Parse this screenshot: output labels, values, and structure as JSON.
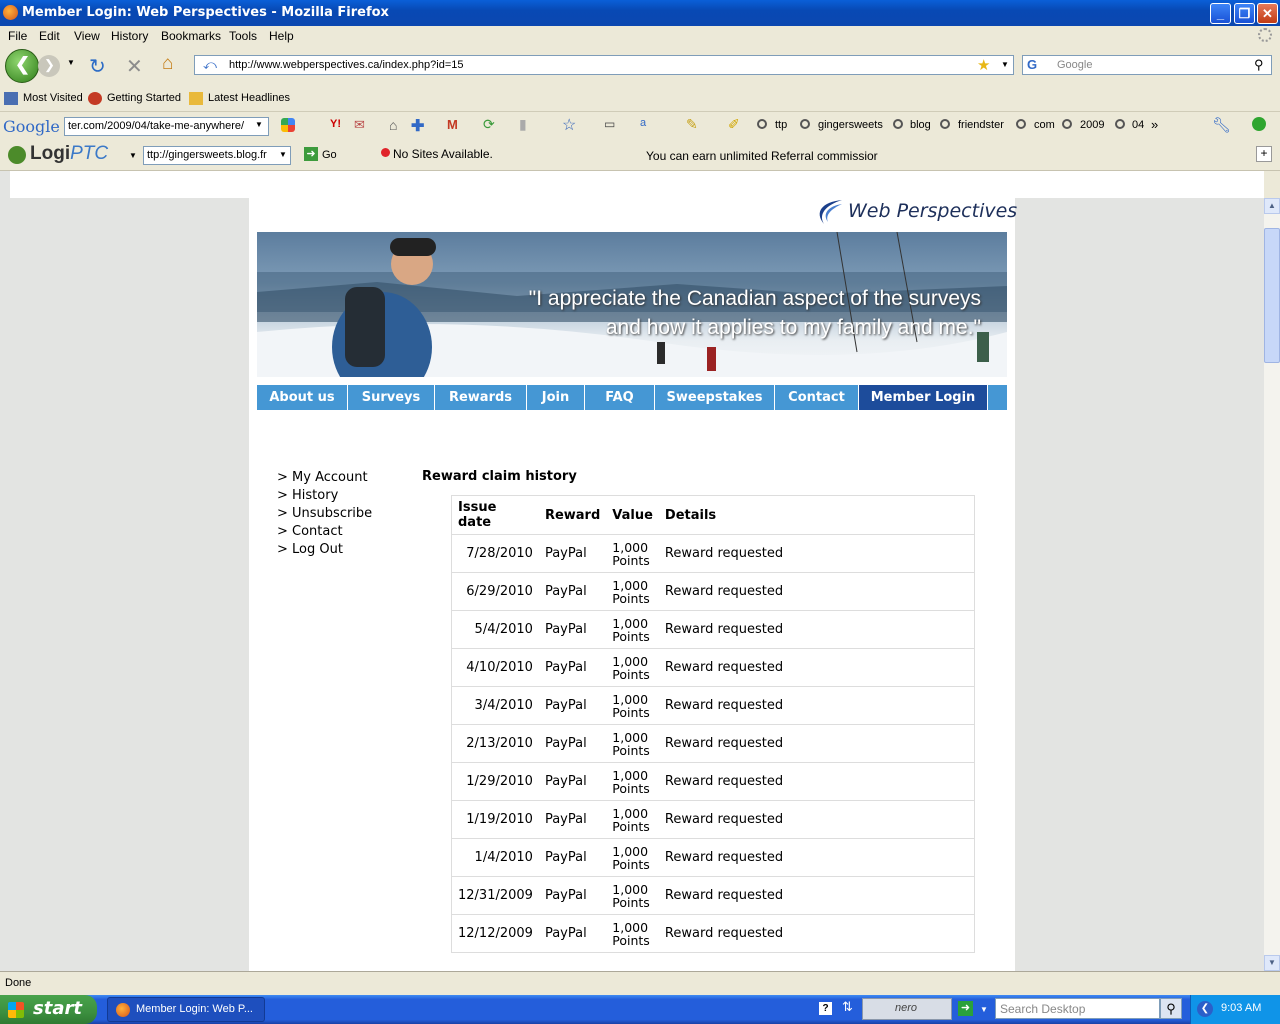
{
  "window": {
    "title": "Member Login: Web Perspectives - Mozilla Firefox"
  },
  "menu": [
    "File",
    "Edit",
    "View",
    "History",
    "Bookmarks",
    "Tools",
    "Help"
  ],
  "nav": {
    "url": "http://www.webperspectives.ca/index.php?id=15",
    "search_placeholder": "Google"
  },
  "bookmarks": [
    "Most Visited",
    "Getting Started",
    "Latest Headlines"
  ],
  "google_toolbar": {
    "logo": "Google",
    "field": "ter.com/2009/04/take-me-anywhere/",
    "links": [
      "ttp",
      "gingersweets",
      "blog",
      "friendster",
      "com",
      "2009",
      "04"
    ],
    "more": "»"
  },
  "logi_toolbar": {
    "logo_a": "Logi",
    "logo_b": "PTC",
    "field": "ttp://gingersweets.blog.fr",
    "go": "Go",
    "sites": "No Sites Available.",
    "ticker": "You can earn unlimited Referral commissior"
  },
  "site": {
    "brand": "Web Perspectives",
    "quote_line1": "\"I appreciate the Canadian aspect of the surveys",
    "quote_line2": "and how it applies to my family and me.\"",
    "tabs": [
      "About us",
      "Surveys",
      "Rewards",
      "Join",
      "FAQ",
      "Sweepstakes",
      "Contact",
      "Member Login"
    ],
    "sidenav": [
      "> My Account",
      "> History",
      "> Unsubscribe",
      "> Contact",
      "> Log Out"
    ],
    "section_title": "Reward claim history",
    "table": {
      "headers": [
        "Issue date",
        "Reward",
        "Value",
        "Details"
      ],
      "value_line1": "1,000",
      "value_line2": "Points",
      "rows": [
        {
          "date": "7/28/2010",
          "reward": "PayPal",
          "details": "Reward requested"
        },
        {
          "date": "6/29/2010",
          "reward": "PayPal",
          "details": "Reward requested"
        },
        {
          "date": "5/4/2010",
          "reward": "PayPal",
          "details": "Reward requested"
        },
        {
          "date": "4/10/2010",
          "reward": "PayPal",
          "details": "Reward requested"
        },
        {
          "date": "3/4/2010",
          "reward": "PayPal",
          "details": "Reward requested"
        },
        {
          "date": "2/13/2010",
          "reward": "PayPal",
          "details": "Reward requested"
        },
        {
          "date": "1/29/2010",
          "reward": "PayPal",
          "details": "Reward requested"
        },
        {
          "date": "1/19/2010",
          "reward": "PayPal",
          "details": "Reward requested"
        },
        {
          "date": "1/4/2010",
          "reward": "PayPal",
          "details": "Reward requested"
        },
        {
          "date": "12/31/2009",
          "reward": "PayPal",
          "details": "Reward requested"
        },
        {
          "date": "12/12/2009",
          "reward": "PayPal",
          "details": "Reward requested"
        }
      ]
    }
  },
  "status": "Done",
  "taskbar": {
    "start": "start",
    "task": "Member Login: Web P...",
    "desktop_search": "Search Desktop",
    "nero": "nero",
    "clock": "9:03 AM"
  }
}
